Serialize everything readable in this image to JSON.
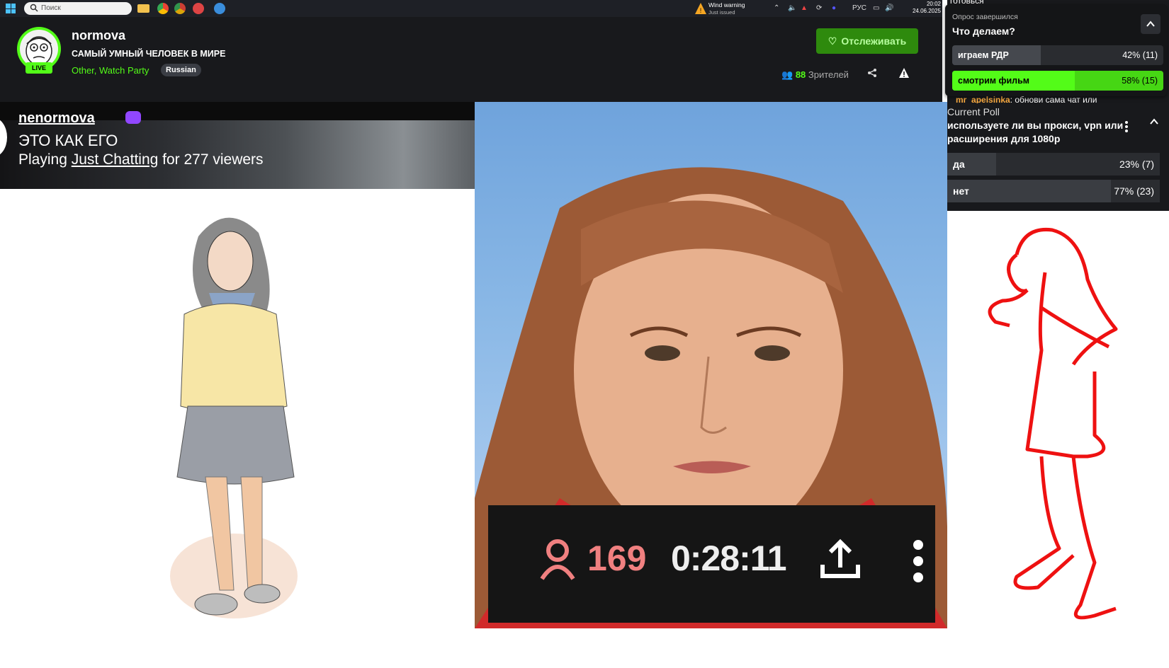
{
  "taskbar": {
    "search_placeholder": "Поиск",
    "weather_title": "Wind warning",
    "weather_sub": "Just issued",
    "weather_alert_count": "1",
    "lang": "РУС",
    "time": "20:02",
    "date": "24.06.2025"
  },
  "channel": {
    "name": "normova",
    "title": "САМЫЙ УМНЫЙ ЧЕЛОВЕК В МИРЕ",
    "categories": "Other, Watch Party",
    "language": "Russian",
    "live_label": "LIVE",
    "follow_label": "Отслеживать",
    "viewer_count": "88",
    "viewer_label": "Зрителей"
  },
  "left_banner": {
    "username": "nenormova",
    "line1": "ЭТО КАК ЕГО",
    "line2_prefix": "Playing",
    "line2_game": "Just Chatting",
    "line2_suffix": "for 277 viewers"
  },
  "video_overlay": {
    "viewers": "169",
    "duration": "0:28:11"
  },
  "chat": {
    "top_text": "готовься",
    "peek_user": "mr_apelsinka",
    "peek_text": ": обнови сама чат или"
  },
  "poll_finished": {
    "label": "Опрос завершился",
    "question": "Что делаем?",
    "options": [
      {
        "text": "играем РДР",
        "result": "42% (11)",
        "percent": 42,
        "winner": false
      },
      {
        "text": "смотрим фильм",
        "result": "58% (15)",
        "percent": 58,
        "winner": true
      }
    ]
  },
  "poll_current": {
    "label": "Current Poll",
    "question": "используете ли вы прокси, vpn или расширения для 1080p",
    "options": [
      {
        "text": "да",
        "result": "23% (7)",
        "percent": 23
      },
      {
        "text": "нет",
        "result": "77% (23)",
        "percent": 77
      }
    ]
  },
  "colors": {
    "accent": "#53fc18",
    "verified": "#9147ff",
    "overlay_count": "#f08080",
    "drawing_red": "#ee1111"
  }
}
